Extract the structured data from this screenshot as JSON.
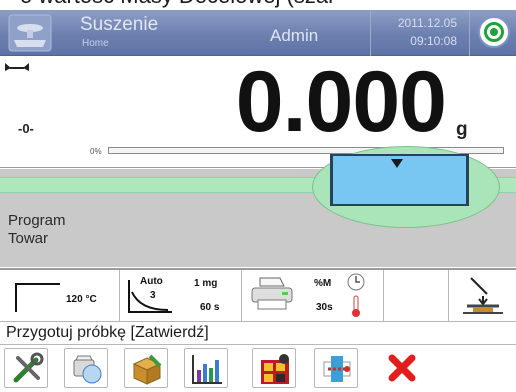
{
  "caption_text": "o wartość Masy Docelowej (szar",
  "header": {
    "app_title": "Suszenie",
    "subtitle": "Home",
    "user": "Admin",
    "date": "2011.12.05",
    "time": "09:10:08"
  },
  "display": {
    "zero_indicator": "-0-",
    "weight": "0.000",
    "unit": "g",
    "progress_label": "0%",
    "progress": 0
  },
  "info_lines": [
    "Program",
    "Towar"
  ],
  "params": {
    "temperature": "120 °C",
    "auto_mode": "Auto",
    "auto_num": "3",
    "delta_mass": "1 mg",
    "delta_time": "60 s",
    "print_unit": "%M",
    "print_interval": "30s"
  },
  "prompt": "Przygotuj próbkę [Zatwierdź]",
  "toolbar": {
    "buttons": [
      "settings-tools-icon",
      "database-icon",
      "products-box-icon",
      "chart-icon",
      "weighing-grid-icon",
      "drying-heater-icon",
      "cancel-icon"
    ]
  },
  "colors": {
    "titlebar": "#6c80b0",
    "bargraph_track": "#ade8bd",
    "bargraph_window": "#78c7f2",
    "bargraph_bg": "#c9c9c9",
    "level_ok": "#20a23a",
    "cancel": "#e11d1d"
  }
}
